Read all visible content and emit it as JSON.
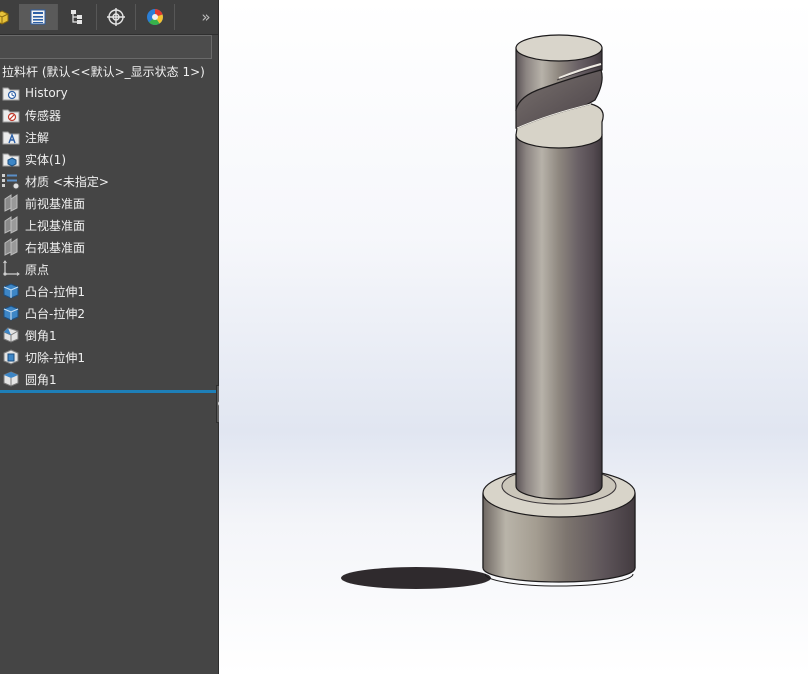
{
  "part_title": "拉料杆 (默认<<默认>_显示状态 1>)",
  "tabs": [
    {
      "name": "display-manager-tab",
      "icon": "appearance-icon"
    },
    {
      "name": "feature-manager-tab",
      "icon": "feature-tree-icon",
      "active": true
    },
    {
      "name": "property-manager-tab",
      "icon": "property-tree-icon"
    },
    {
      "name": "configuration-manager-tab",
      "icon": "crosshair-icon"
    },
    {
      "name": "dimxpert-tab",
      "icon": "color-wheel-icon"
    }
  ],
  "expand_glyph": "»",
  "tree": [
    {
      "label": "History",
      "icon": "history-folder-icon"
    },
    {
      "label": "传感器",
      "icon": "sensor-folder-icon"
    },
    {
      "label": "注解",
      "icon": "annotation-folder-icon"
    },
    {
      "label": "实体(1)",
      "icon": "solid-bodies-folder-icon"
    },
    {
      "label": "材质 <未指定>",
      "icon": "material-icon"
    },
    {
      "label": "前视基准面",
      "icon": "plane-icon"
    },
    {
      "label": "上视基准面",
      "icon": "plane-icon"
    },
    {
      "label": "右视基准面",
      "icon": "plane-icon"
    },
    {
      "label": "原点",
      "icon": "origin-icon"
    },
    {
      "label": "凸台-拉伸1",
      "icon": "boss-extrude-icon"
    },
    {
      "label": "凸台-拉伸2",
      "icon": "boss-extrude-icon"
    },
    {
      "label": "倒角1",
      "icon": "chamfer-icon"
    },
    {
      "label": "切除-拉伸1",
      "icon": "cut-extrude-icon"
    },
    {
      "label": "圆角1",
      "icon": "fillet-icon"
    }
  ],
  "colors": {
    "panel_bg": "#454545",
    "rollback_bar": "#1e7fb8",
    "model_light": "#d9d5cb",
    "model_dark": "#514a4e"
  }
}
